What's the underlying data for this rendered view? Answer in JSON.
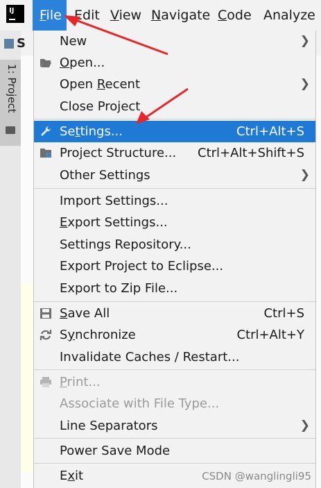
{
  "app": {
    "logo_text": "IJ"
  },
  "menubar": {
    "items": [
      {
        "label": "File",
        "mnemonic": "F",
        "rest": "ile"
      },
      {
        "label": "Edit",
        "mnemonic": "",
        "rest": "Edit"
      },
      {
        "label": "View",
        "mnemonic": "V",
        "rest": "iew"
      },
      {
        "label": "Navigate",
        "mnemonic": "N",
        "rest": "avigate"
      },
      {
        "label": "Code",
        "mnemonic": "C",
        "rest": "ode"
      },
      {
        "label": "Analyze",
        "mnemonic": "",
        "rest": "Analyze"
      }
    ]
  },
  "background": {
    "project_initial": "S",
    "tool_window_label": "1: Project"
  },
  "file_menu": {
    "new": {
      "label": "New"
    },
    "open": {
      "label": "Open...",
      "mn": "O",
      "rest": "pen..."
    },
    "open_recent": {
      "pre": "Open ",
      "mn": "R",
      "rest": "ecent"
    },
    "close_project": {
      "label": "Close Project"
    },
    "settings": {
      "label": "Settings...",
      "mn": "t",
      "pre": "Se",
      "rest": "tings...",
      "shortcut": "Ctrl+Alt+S"
    },
    "project_structure": {
      "label": "Project Structure...",
      "shortcut": "Ctrl+Alt+Shift+S"
    },
    "other_settings": {
      "label": "Other Settings"
    },
    "import_settings": {
      "label": "Import Settings..."
    },
    "export_settings": {
      "mn": "E",
      "rest": "xport Settings..."
    },
    "settings_repository": {
      "label": "Settings Repository..."
    },
    "export_eclipse": {
      "label": "Export Project to Eclipse..."
    },
    "export_zip": {
      "label": "Export to Zip File..."
    },
    "save_all": {
      "mn": "S",
      "rest": "ave All",
      "shortcut": "Ctrl+S"
    },
    "synchronize": {
      "mn": "y",
      "pre": "S",
      "rest": "nchronize",
      "shortcut": "Ctrl+Alt+Y"
    },
    "invalidate": {
      "label": "Invalidate Caches / Restart..."
    },
    "print": {
      "mn": "P",
      "rest": "rint..."
    },
    "associate": {
      "label": "Associate with File Type..."
    },
    "line_separators": {
      "label": "Line Separators"
    },
    "power_save": {
      "label": "Power Save Mode"
    },
    "exit": {
      "pre": "E",
      "mn": "x",
      "rest": "it"
    }
  },
  "watermark": "CSDN @wanglingli95",
  "colors": {
    "menu_selected": "#1f7ad6",
    "menubar_active": "#2a82da",
    "annotation_arrow": "#e8262a"
  }
}
